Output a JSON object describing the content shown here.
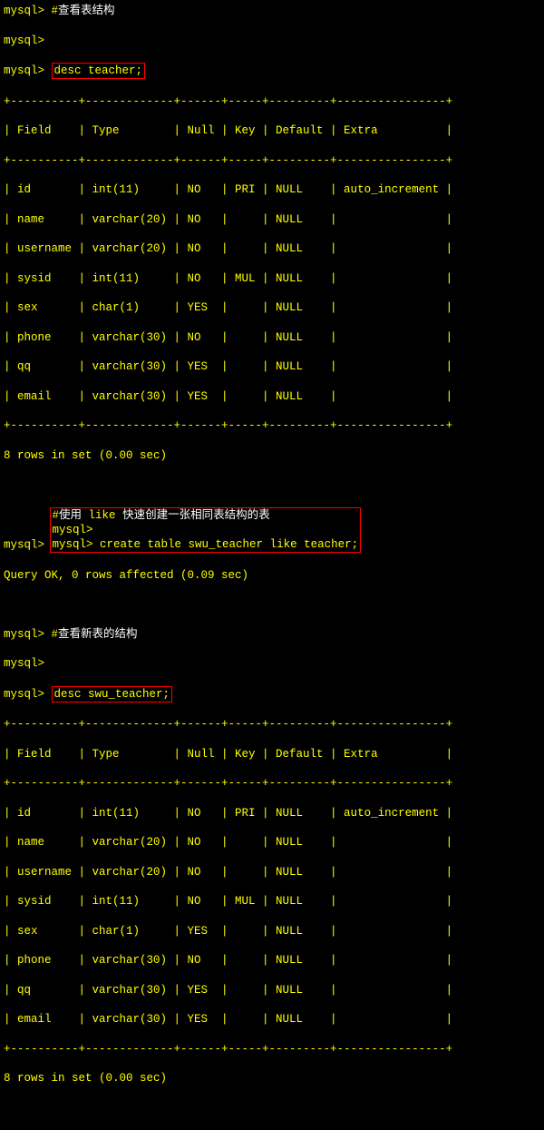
{
  "section1": {
    "comment_prefix": "mysql> ",
    "comment_hash": "#",
    "comment_text": "查看表结构",
    "prompt2": "mysql>",
    "prompt3": "mysql> ",
    "cmd1": "desc teacher;"
  },
  "table1": {
    "border_top": "+----------+-------------+------+-----+---------+----------------+",
    "header": "| Field    | Type        | Null | Key | Default | Extra          |",
    "border_mid": "+----------+-------------+------+-----+---------+----------------+",
    "rows": [
      "| id       | int(11)     | NO   | PRI | NULL    | auto_increment |",
      "| name     | varchar(20) | NO   |     | NULL    |                |",
      "| username | varchar(20) | NO   |     | NULL    |                |",
      "| sysid    | int(11)     | NO   | MUL | NULL    |                |",
      "| sex      | char(1)     | YES  |     | NULL    |                |",
      "| phone    | varchar(30) | NO   |     | NULL    |                |",
      "| qq       | varchar(30) | YES  |     | NULL    |                |",
      "| email    | varchar(30) | YES  |     | NULL    |                |"
    ],
    "border_bot": "+----------+-------------+------+-----+---------+----------------+",
    "footer": "8 rows in set (0.00 sec)"
  },
  "section2": {
    "prompt1": "mysql> ",
    "hash": "#",
    "comment_cn1": "使用",
    "like_word": " like ",
    "comment_cn2": "快速创建一张相同表结构的表",
    "prompt2": "mysql>",
    "prompt3": "mysql> ",
    "cmd": "create table swu_teacher like teacher;",
    "result": "Query OK, 0 rows affected (0.09 sec)"
  },
  "section3": {
    "prompt1": "mysql> ",
    "hash": "#",
    "comment": "查看新表的结构",
    "prompt2": "mysql>",
    "prompt3": "mysql> ",
    "cmd": "desc swu_teacher;"
  },
  "table2": {
    "border_top": "+----------+-------------+------+-----+---------+----------------+",
    "header": "| Field    | Type        | Null | Key | Default | Extra          |",
    "border_mid": "+----------+-------------+------+-----+---------+----------------+",
    "rows": [
      "| id       | int(11)     | NO   | PRI | NULL    | auto_increment |",
      "| name     | varchar(20) | NO   |     | NULL    |                |",
      "| username | varchar(20) | NO   |     | NULL    |                |",
      "| sysid    | int(11)     | NO   | MUL | NULL    |                |",
      "| sex      | char(1)     | YES  |     | NULL    |                |",
      "| phone    | varchar(30) | NO   |     | NULL    |                |",
      "| qq       | varchar(30) | YES  |     | NULL    |                |",
      "| email    | varchar(30) | YES  |     | NULL    |                |"
    ],
    "border_bot": "+----------+-------------+------+-----+---------+----------------+",
    "footer": "8 rows in set (0.00 sec)"
  },
  "chart_data": {
    "type": "table",
    "title": "MySQL DESCRIBE output for teacher / swu_teacher",
    "columns": [
      "Field",
      "Type",
      "Null",
      "Key",
      "Default",
      "Extra"
    ],
    "rows": [
      [
        "id",
        "int(11)",
        "NO",
        "PRI",
        "NULL",
        "auto_increment"
      ],
      [
        "name",
        "varchar(20)",
        "NO",
        "",
        "NULL",
        ""
      ],
      [
        "username",
        "varchar(20)",
        "NO",
        "",
        "NULL",
        ""
      ],
      [
        "sysid",
        "int(11)",
        "NO",
        "MUL",
        "NULL",
        ""
      ],
      [
        "sex",
        "char(1)",
        "YES",
        "",
        "NULL",
        ""
      ],
      [
        "phone",
        "varchar(30)",
        "NO",
        "",
        "NULL",
        ""
      ],
      [
        "qq",
        "varchar(30)",
        "YES",
        "",
        "NULL",
        ""
      ],
      [
        "email",
        "varchar(30)",
        "YES",
        "",
        "NULL",
        ""
      ]
    ]
  }
}
